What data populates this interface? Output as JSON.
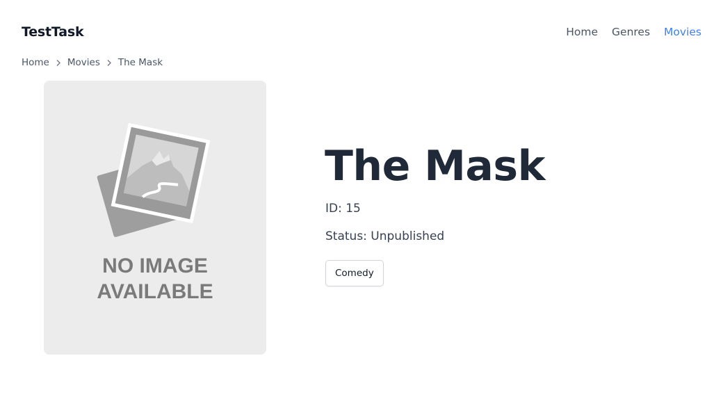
{
  "brand": "TestTask",
  "nav": {
    "home": "Home",
    "genres": "Genres",
    "movies": "Movies"
  },
  "breadcrumb": {
    "home": "Home",
    "movies": "Movies",
    "current": "The Mask"
  },
  "poster": {
    "line1": "NO IMAGE",
    "line2": "AVAILABLE",
    "icon": "image-placeholder-icon"
  },
  "movie": {
    "title": "The Mask",
    "id_text": "ID: 15",
    "status_text": "Status: Unpublished",
    "genres": [
      "Comedy"
    ]
  },
  "colors": {
    "accent": "#3b82f6",
    "placeholder_bg": "#ececec",
    "placeholder_fg": "#7a7a7a"
  }
}
